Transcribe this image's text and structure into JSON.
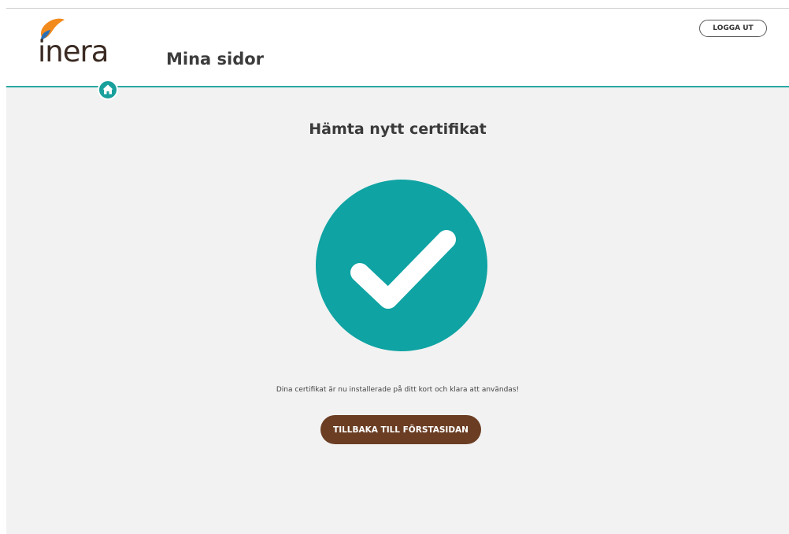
{
  "header": {
    "logo_text": "inera",
    "app_title": "Mina sidor",
    "logout_label": "LOGGA UT",
    "home_icon": "home-icon"
  },
  "main": {
    "heading": "Hämta nytt certifikat",
    "status_icon": "checkmark-icon",
    "message": "Dina certifikat är nu installerade på ditt kort och klara att användas!",
    "back_button_label": "TILLBAKA TILL FÖRSTASIDAN"
  },
  "colors": {
    "accent_teal": "#19a09c",
    "header_line": "#2aa8a4",
    "button_brown": "#6b3e24",
    "logo_orange": "#f28a1c",
    "logo_blue": "#2a6fb5",
    "background": "#f2f2f2"
  }
}
